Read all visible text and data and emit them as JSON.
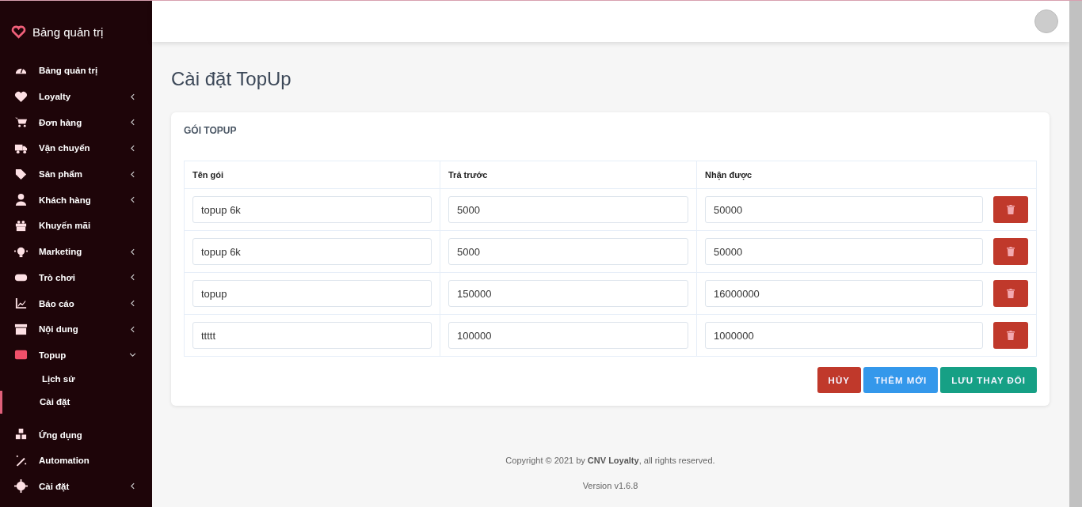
{
  "sidebar": {
    "brand": "Bảng quản trị",
    "items": [
      {
        "label": "Bảng quản trị",
        "has_submenu": false,
        "expanded": false
      },
      {
        "label": "Loyalty",
        "has_submenu": true,
        "expanded": false
      },
      {
        "label": "Đơn hàng",
        "has_submenu": true,
        "expanded": false
      },
      {
        "label": "Vận chuyển",
        "has_submenu": true,
        "expanded": false
      },
      {
        "label": "Sản phẩm",
        "has_submenu": true,
        "expanded": false
      },
      {
        "label": "Khách hàng",
        "has_submenu": true,
        "expanded": false
      },
      {
        "label": "Khuyến mãi",
        "has_submenu": false,
        "expanded": false
      },
      {
        "label": "Marketing",
        "has_submenu": true,
        "expanded": false
      },
      {
        "label": "Trò chơi",
        "has_submenu": true,
        "expanded": false
      },
      {
        "label": "Báo cáo",
        "has_submenu": true,
        "expanded": false
      },
      {
        "label": "Nội dung",
        "has_submenu": true,
        "expanded": false
      },
      {
        "label": "Topup",
        "has_submenu": true,
        "expanded": true,
        "children": [
          {
            "label": "Lịch sử",
            "selected": false
          },
          {
            "label": "Cài đặt",
            "selected": true
          }
        ]
      },
      {
        "label": "Ứng dụng",
        "has_submenu": false,
        "expanded": false
      },
      {
        "label": "Automation",
        "has_submenu": false,
        "expanded": false
      },
      {
        "label": "Cài đặt",
        "has_submenu": true,
        "expanded": false
      }
    ]
  },
  "page_title": "Cài đặt TopUp",
  "card": {
    "title": "GÓI TOPUP",
    "columns": [
      "Tên gói",
      "Trả trước",
      "Nhận được"
    ],
    "rows": [
      {
        "name": "topup 6k",
        "prepaid": "5000",
        "received": "50000"
      },
      {
        "name": "topup 6k",
        "prepaid": "5000",
        "received": "50000"
      },
      {
        "name": "topup",
        "prepaid": "150000",
        "received": "16000000"
      },
      {
        "name": "ttttt",
        "prepaid": "100000",
        "received": "1000000"
      }
    ],
    "buttons": [
      {
        "label": "HỦY",
        "kind": "danger"
      },
      {
        "label": "THÊM MỚI",
        "kind": "info"
      },
      {
        "label": "LƯU THAY ĐỔI",
        "kind": "success"
      }
    ]
  },
  "footer": {
    "copyright": "Copyright © 2021 by **CNV Loyalty**, all rights reserved.",
    "version": "Version v1.6.8"
  }
}
